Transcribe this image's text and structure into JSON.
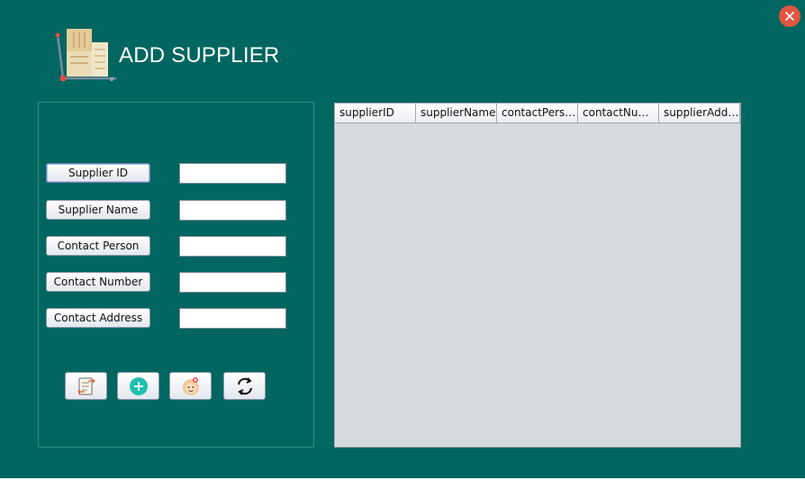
{
  "window": {
    "title": "ADD SUPPLIER",
    "close_icon": "close-icon"
  },
  "form": {
    "fields": [
      {
        "label": "Supplier ID",
        "value": ""
      },
      {
        "label": "Supplier Name",
        "value": ""
      },
      {
        "label": "Contact Person",
        "value": ""
      },
      {
        "label": "Contact Number",
        "value": ""
      },
      {
        "label": "Contact Address",
        "value": ""
      }
    ],
    "actions": [
      {
        "icon": "update-document-icon"
      },
      {
        "icon": "add-icon"
      },
      {
        "icon": "delete-icon"
      },
      {
        "icon": "refresh-icon"
      }
    ]
  },
  "table": {
    "columns": [
      "supplierID",
      "supplierName",
      "contactPerson",
      "contactNum...",
      "supplierAddr..."
    ],
    "rows": []
  },
  "colors": {
    "background": "#00665f",
    "table_background": "#d6d9e0",
    "close_button": "#e05542",
    "add_button": "#1fbfae"
  }
}
